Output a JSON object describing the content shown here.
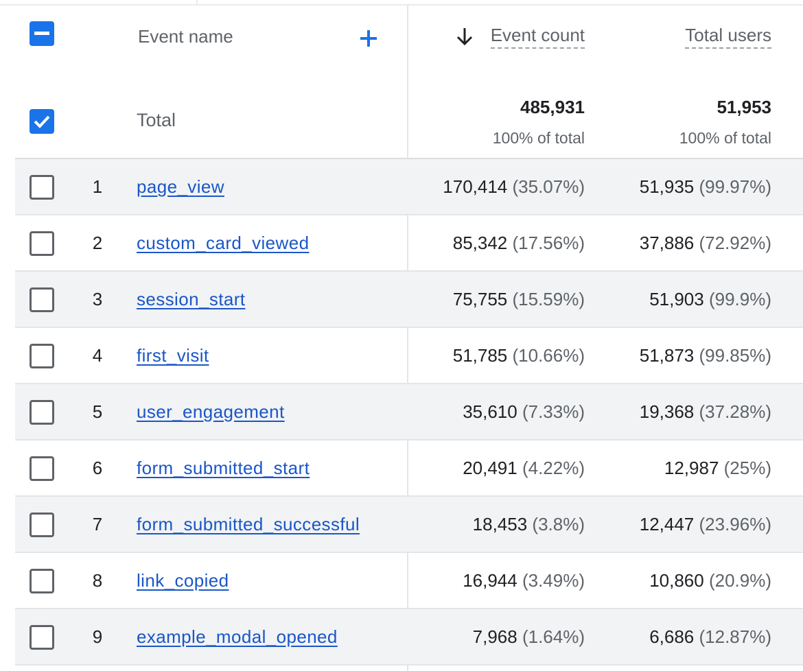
{
  "header": {
    "event_name_label": "Event name",
    "event_count_label": "Event count",
    "total_users_label": "Total users",
    "sort": "descending",
    "sort_icon": "arrow-down-icon",
    "add_icon": "plus-icon"
  },
  "totals": {
    "label": "Total",
    "event_count": "485,931",
    "event_count_pct": "100% of total",
    "total_users": "51,953",
    "total_users_pct": "100% of total"
  },
  "colors": {
    "accent": "#1a73e8",
    "link": "#1a56c8",
    "row_shade": "#f1f3f4"
  },
  "rows": [
    {
      "index": "1",
      "name": "page_view",
      "event_count": "170,414",
      "event_count_pct": "(35.07%)",
      "total_users": "51,935",
      "total_users_pct": "(99.97%)"
    },
    {
      "index": "2",
      "name": "custom_card_viewed",
      "event_count": "85,342",
      "event_count_pct": "(17.56%)",
      "total_users": "37,886",
      "total_users_pct": "(72.92%)"
    },
    {
      "index": "3",
      "name": "session_start",
      "event_count": "75,755",
      "event_count_pct": "(15.59%)",
      "total_users": "51,903",
      "total_users_pct": "(99.9%)"
    },
    {
      "index": "4",
      "name": "first_visit",
      "event_count": "51,785",
      "event_count_pct": "(10.66%)",
      "total_users": "51,873",
      "total_users_pct": "(99.85%)"
    },
    {
      "index": "5",
      "name": "user_engagement",
      "event_count": "35,610",
      "event_count_pct": "(7.33%)",
      "total_users": "19,368",
      "total_users_pct": "(37.28%)"
    },
    {
      "index": "6",
      "name": "form_submitted_start",
      "event_count": "20,491",
      "event_count_pct": "(4.22%)",
      "total_users": "12,987",
      "total_users_pct": "(25%)"
    },
    {
      "index": "7",
      "name": "form_submitted_successful",
      "event_count": "18,453",
      "event_count_pct": "(3.8%)",
      "total_users": "12,447",
      "total_users_pct": "(23.96%)"
    },
    {
      "index": "8",
      "name": "link_copied",
      "event_count": "16,944",
      "event_count_pct": "(3.49%)",
      "total_users": "10,860",
      "total_users_pct": "(20.9%)"
    },
    {
      "index": "9",
      "name": "example_modal_opened",
      "event_count": "7,968",
      "event_count_pct": "(1.64%)",
      "total_users": "6,686",
      "total_users_pct": "(12.87%)"
    }
  ]
}
